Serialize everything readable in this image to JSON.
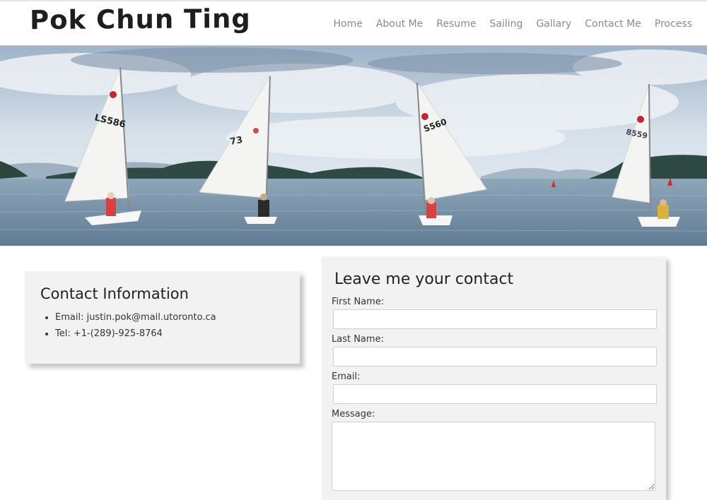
{
  "header": {
    "site_title": "Pok Chun Ting",
    "nav": [
      "Home",
      "About Me",
      "Resume",
      "Sailing",
      "Gallary",
      "Contact Me",
      "Process"
    ]
  },
  "hero": {
    "sail_numbers": [
      "LS586",
      "73",
      "S560",
      "8559"
    ]
  },
  "contact_info": {
    "heading": "Contact Information",
    "email": "Email: justin.pok@mail.utoronto.ca",
    "tel": "Tel: +1-(289)-925-8764"
  },
  "form": {
    "heading": "Leave me your contact",
    "first_name_label": "First Name:",
    "last_name_label": "Last Name:",
    "email_label": "Email:",
    "message_label": "Message:",
    "first_name_value": "",
    "last_name_value": "",
    "email_value": "",
    "message_value": ""
  },
  "colors": {
    "card_background": "#f2f2f2",
    "nav_text": "#8a8a8a",
    "sky": "#c9d8e6",
    "water": "#6f8ba3",
    "hills": "#2f4a44"
  }
}
